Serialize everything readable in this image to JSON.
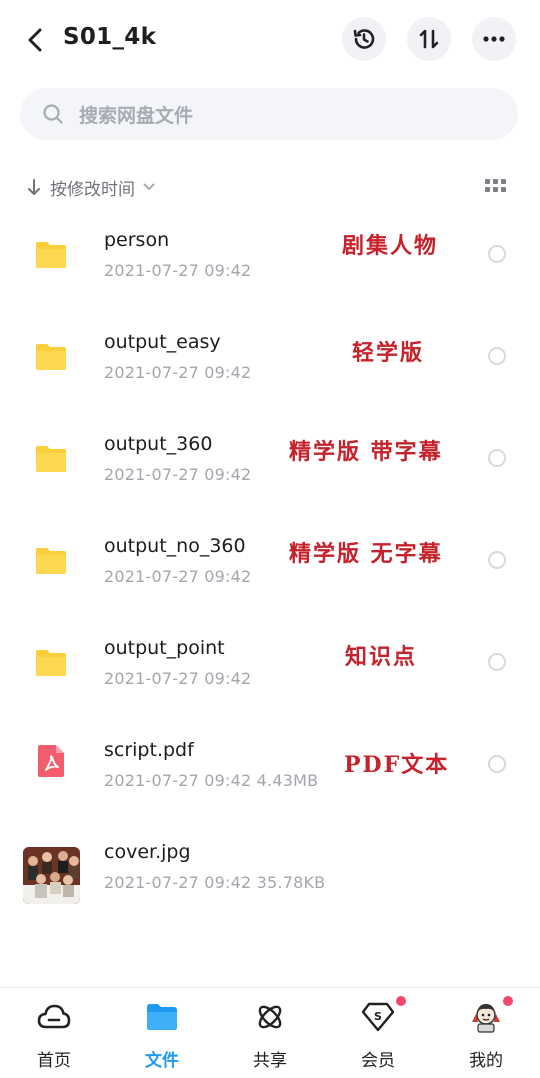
{
  "header": {
    "title": "S01_4k"
  },
  "search": {
    "placeholder": "搜索网盘文件"
  },
  "sort": {
    "label": "按修改时间"
  },
  "files": [
    {
      "name": "person",
      "meta": "2021-07-27  09:42",
      "type": "folder",
      "annotation": "剧集人物"
    },
    {
      "name": "output_easy",
      "meta": "2021-07-27  09:42",
      "type": "folder",
      "annotation": "轻学版"
    },
    {
      "name": "output_360",
      "meta": "2021-07-27  09:42",
      "type": "folder",
      "annotation": "精学版 带字幕"
    },
    {
      "name": "output_no_360",
      "meta": "2021-07-27  09:42",
      "type": "folder",
      "annotation": "精学版 无字幕"
    },
    {
      "name": "output_point",
      "meta": "2021-07-27  09:42",
      "type": "folder",
      "annotation": "知识点"
    },
    {
      "name": "script.pdf",
      "meta": "2021-07-27  09:42   4.43MB",
      "type": "pdf",
      "annotation": "PDF文本"
    },
    {
      "name": "cover.jpg",
      "meta": "2021-07-27  09:42   35.78KB",
      "type": "image",
      "annotation": ""
    }
  ],
  "nav": [
    {
      "label": "首页",
      "icon": "cloud-home-icon",
      "active": false
    },
    {
      "label": "文件",
      "icon": "folder-icon",
      "active": true
    },
    {
      "label": "共享",
      "icon": "atom-share-icon",
      "active": false
    },
    {
      "label": "会员",
      "icon": "vip-diamond-icon",
      "active": false,
      "badge": true
    },
    {
      "label": "我的",
      "icon": "avatar-icon",
      "active": false,
      "badge": true
    }
  ],
  "colors": {
    "accent": "#1e9bf0",
    "folder": "#f9cf3b",
    "annotation": "#c6222c",
    "badge": "#f4476b"
  }
}
